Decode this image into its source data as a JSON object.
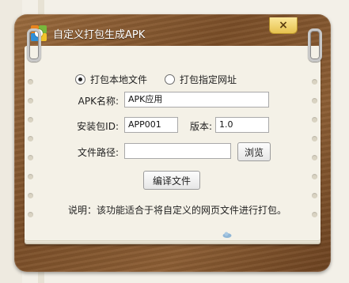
{
  "window": {
    "title": "自定义打包生成APK",
    "close_label": "×"
  },
  "mode": {
    "options": [
      {
        "label": "打包本地文件",
        "selected": true
      },
      {
        "label": "打包指定网址",
        "selected": false
      }
    ]
  },
  "form": {
    "apk_name_label": "APK名称:",
    "apk_name_value": "APK应用",
    "package_id_label": "安装包ID:",
    "package_id_value": "APP001",
    "version_label": "版本:",
    "version_value": "1.0",
    "file_path_label": "文件路径:",
    "file_path_value": "",
    "browse_label": "浏览",
    "compile_label": "编译文件"
  },
  "note": "说明：该功能适合于将自定义的网页文件进行打包。",
  "colors": {
    "board": "#7a4e28",
    "paper": "#f4f1e7",
    "close_button": "#e7c24e"
  }
}
